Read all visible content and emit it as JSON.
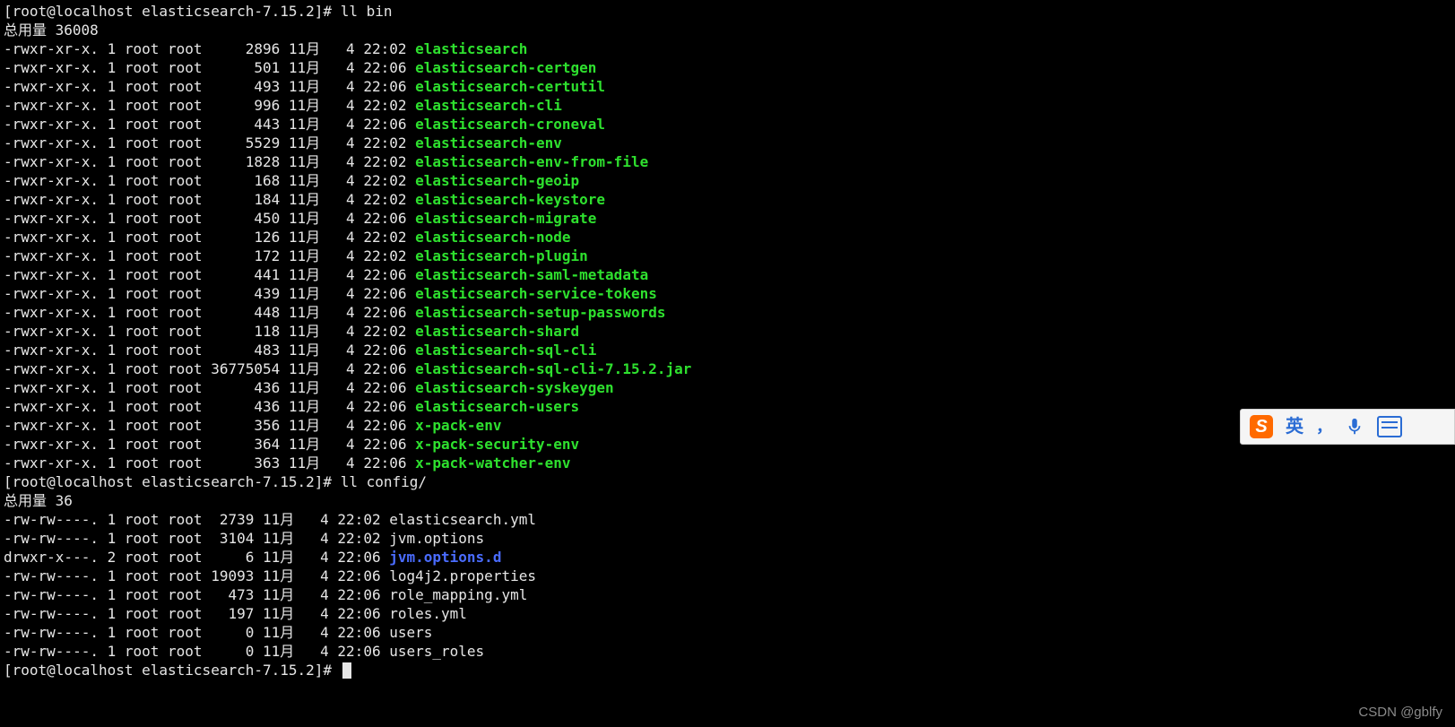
{
  "prompt_text": "[root@localhost elasticsearch-7.15.2]#",
  "cmd1": "ll bin",
  "total1": "总用量 36008",
  "bin_listing": [
    {
      "perm": "-rwxr-xr-x.",
      "links": "1",
      "owner": "root",
      "group": "root",
      "size": "2896",
      "month": "11月",
      "day": "4",
      "time": "22:02",
      "name": "elasticsearch",
      "type": "exec"
    },
    {
      "perm": "-rwxr-xr-x.",
      "links": "1",
      "owner": "root",
      "group": "root",
      "size": "501",
      "month": "11月",
      "day": "4",
      "time": "22:06",
      "name": "elasticsearch-certgen",
      "type": "exec"
    },
    {
      "perm": "-rwxr-xr-x.",
      "links": "1",
      "owner": "root",
      "group": "root",
      "size": "493",
      "month": "11月",
      "day": "4",
      "time": "22:06",
      "name": "elasticsearch-certutil",
      "type": "exec"
    },
    {
      "perm": "-rwxr-xr-x.",
      "links": "1",
      "owner": "root",
      "group": "root",
      "size": "996",
      "month": "11月",
      "day": "4",
      "time": "22:02",
      "name": "elasticsearch-cli",
      "type": "exec"
    },
    {
      "perm": "-rwxr-xr-x.",
      "links": "1",
      "owner": "root",
      "group": "root",
      "size": "443",
      "month": "11月",
      "day": "4",
      "time": "22:06",
      "name": "elasticsearch-croneval",
      "type": "exec"
    },
    {
      "perm": "-rwxr-xr-x.",
      "links": "1",
      "owner": "root",
      "group": "root",
      "size": "5529",
      "month": "11月",
      "day": "4",
      "time": "22:02",
      "name": "elasticsearch-env",
      "type": "exec"
    },
    {
      "perm": "-rwxr-xr-x.",
      "links": "1",
      "owner": "root",
      "group": "root",
      "size": "1828",
      "month": "11月",
      "day": "4",
      "time": "22:02",
      "name": "elasticsearch-env-from-file",
      "type": "exec"
    },
    {
      "perm": "-rwxr-xr-x.",
      "links": "1",
      "owner": "root",
      "group": "root",
      "size": "168",
      "month": "11月",
      "day": "4",
      "time": "22:02",
      "name": "elasticsearch-geoip",
      "type": "exec"
    },
    {
      "perm": "-rwxr-xr-x.",
      "links": "1",
      "owner": "root",
      "group": "root",
      "size": "184",
      "month": "11月",
      "day": "4",
      "time": "22:02",
      "name": "elasticsearch-keystore",
      "type": "exec"
    },
    {
      "perm": "-rwxr-xr-x.",
      "links": "1",
      "owner": "root",
      "group": "root",
      "size": "450",
      "month": "11月",
      "day": "4",
      "time": "22:06",
      "name": "elasticsearch-migrate",
      "type": "exec"
    },
    {
      "perm": "-rwxr-xr-x.",
      "links": "1",
      "owner": "root",
      "group": "root",
      "size": "126",
      "month": "11月",
      "day": "4",
      "time": "22:02",
      "name": "elasticsearch-node",
      "type": "exec"
    },
    {
      "perm": "-rwxr-xr-x.",
      "links": "1",
      "owner": "root",
      "group": "root",
      "size": "172",
      "month": "11月",
      "day": "4",
      "time": "22:02",
      "name": "elasticsearch-plugin",
      "type": "exec"
    },
    {
      "perm": "-rwxr-xr-x.",
      "links": "1",
      "owner": "root",
      "group": "root",
      "size": "441",
      "month": "11月",
      "day": "4",
      "time": "22:06",
      "name": "elasticsearch-saml-metadata",
      "type": "exec"
    },
    {
      "perm": "-rwxr-xr-x.",
      "links": "1",
      "owner": "root",
      "group": "root",
      "size": "439",
      "month": "11月",
      "day": "4",
      "time": "22:06",
      "name": "elasticsearch-service-tokens",
      "type": "exec"
    },
    {
      "perm": "-rwxr-xr-x.",
      "links": "1",
      "owner": "root",
      "group": "root",
      "size": "448",
      "month": "11月",
      "day": "4",
      "time": "22:06",
      "name": "elasticsearch-setup-passwords",
      "type": "exec"
    },
    {
      "perm": "-rwxr-xr-x.",
      "links": "1",
      "owner": "root",
      "group": "root",
      "size": "118",
      "month": "11月",
      "day": "4",
      "time": "22:02",
      "name": "elasticsearch-shard",
      "type": "exec"
    },
    {
      "perm": "-rwxr-xr-x.",
      "links": "1",
      "owner": "root",
      "group": "root",
      "size": "483",
      "month": "11月",
      "day": "4",
      "time": "22:06",
      "name": "elasticsearch-sql-cli",
      "type": "exec"
    },
    {
      "perm": "-rwxr-xr-x.",
      "links": "1",
      "owner": "root",
      "group": "root",
      "size": "36775054",
      "month": "11月",
      "day": "4",
      "time": "22:06",
      "name": "elasticsearch-sql-cli-7.15.2.jar",
      "type": "exec"
    },
    {
      "perm": "-rwxr-xr-x.",
      "links": "1",
      "owner": "root",
      "group": "root",
      "size": "436",
      "month": "11月",
      "day": "4",
      "time": "22:06",
      "name": "elasticsearch-syskeygen",
      "type": "exec"
    },
    {
      "perm": "-rwxr-xr-x.",
      "links": "1",
      "owner": "root",
      "group": "root",
      "size": "436",
      "month": "11月",
      "day": "4",
      "time": "22:06",
      "name": "elasticsearch-users",
      "type": "exec"
    },
    {
      "perm": "-rwxr-xr-x.",
      "links": "1",
      "owner": "root",
      "group": "root",
      "size": "356",
      "month": "11月",
      "day": "4",
      "time": "22:06",
      "name": "x-pack-env",
      "type": "exec"
    },
    {
      "perm": "-rwxr-xr-x.",
      "links": "1",
      "owner": "root",
      "group": "root",
      "size": "364",
      "month": "11月",
      "day": "4",
      "time": "22:06",
      "name": "x-pack-security-env",
      "type": "exec"
    },
    {
      "perm": "-rwxr-xr-x.",
      "links": "1",
      "owner": "root",
      "group": "root",
      "size": "363",
      "month": "11月",
      "day": "4",
      "time": "22:06",
      "name": "x-pack-watcher-env",
      "type": "exec"
    }
  ],
  "cmd2": "ll config/",
  "total2": "总用量 36",
  "config_listing": [
    {
      "perm": "-rw-rw----.",
      "links": "1",
      "owner": "root",
      "group": "root",
      "size": "2739",
      "month": "11月",
      "day": "4",
      "time": "22:02",
      "name": "elasticsearch.yml",
      "type": "plain"
    },
    {
      "perm": "-rw-rw----.",
      "links": "1",
      "owner": "root",
      "group": "root",
      "size": "3104",
      "month": "11月",
      "day": "4",
      "time": "22:02",
      "name": "jvm.options",
      "type": "plain"
    },
    {
      "perm": "drwxr-x---.",
      "links": "2",
      "owner": "root",
      "group": "root",
      "size": "6",
      "month": "11月",
      "day": "4",
      "time": "22:06",
      "name": "jvm.options.d",
      "type": "dir"
    },
    {
      "perm": "-rw-rw----.",
      "links": "1",
      "owner": "root",
      "group": "root",
      "size": "19093",
      "month": "11月",
      "day": "4",
      "time": "22:06",
      "name": "log4j2.properties",
      "type": "plain"
    },
    {
      "perm": "-rw-rw----.",
      "links": "1",
      "owner": "root",
      "group": "root",
      "size": "473",
      "month": "11月",
      "day": "4",
      "time": "22:06",
      "name": "role_mapping.yml",
      "type": "plain"
    },
    {
      "perm": "-rw-rw----.",
      "links": "1",
      "owner": "root",
      "group": "root",
      "size": "197",
      "month": "11月",
      "day": "4",
      "time": "22:06",
      "name": "roles.yml",
      "type": "plain"
    },
    {
      "perm": "-rw-rw----.",
      "links": "1",
      "owner": "root",
      "group": "root",
      "size": "0",
      "month": "11月",
      "day": "4",
      "time": "22:06",
      "name": "users",
      "type": "plain"
    },
    {
      "perm": "-rw-rw----.",
      "links": "1",
      "owner": "root",
      "group": "root",
      "size": "0",
      "month": "11月",
      "day": "4",
      "time": "22:06",
      "name": "users_roles",
      "type": "plain"
    }
  ],
  "watermark": "CSDN @gblfy",
  "ime": {
    "logo": "S",
    "lang": "英",
    "sep": "，"
  },
  "col_widths": {
    "size_bin": 8,
    "size_config": 5,
    "day": 3
  }
}
